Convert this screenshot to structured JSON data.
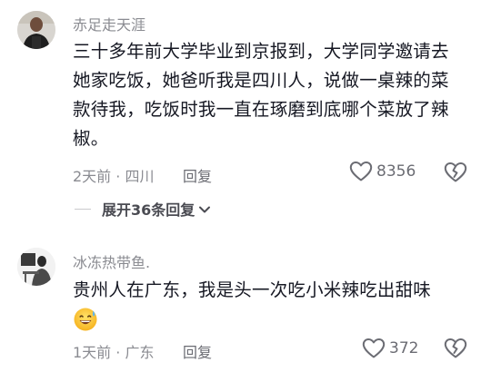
{
  "comments": [
    {
      "username": "赤足走天涯",
      "lines": [
        "三十多年前大学毕业到京报到，大学同学邀请去",
        "她家吃饭，她爸听我是四川人，说做一桌辣的菜",
        "款待我，吃饭时我一直在琢磨到底哪个菜放了辣",
        "椒。"
      ],
      "time": "2天前",
      "location": "四川",
      "reply_label": "回复",
      "likes": "8356",
      "expand_label": "展开36条回复"
    },
    {
      "username": "冰冻热带鱼.",
      "lines": [
        "贵州人在广东，我是头一次吃小米辣吃出甜味"
      ],
      "emoji": "grinning-sweat-emoji",
      "time": "1天前",
      "location": "广东",
      "reply_label": "回复",
      "likes": "372"
    }
  ],
  "meta_separator": " · ",
  "icons": {
    "like": "heart-outline-icon",
    "dislike": "broken-heart-icon",
    "expand": "chevron-down-icon"
  },
  "colors": {
    "text": "#161823",
    "secondary": "#8a8b91",
    "icon": "#6b6c73"
  }
}
